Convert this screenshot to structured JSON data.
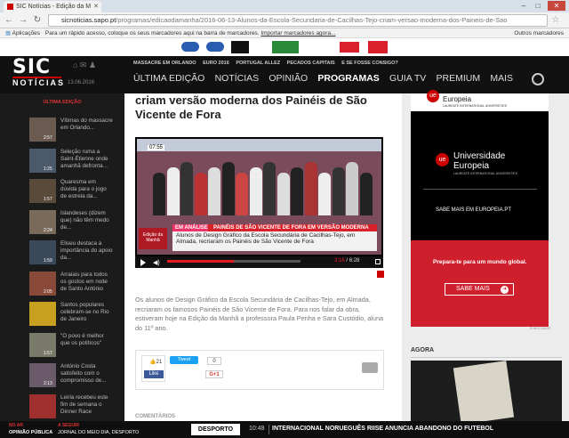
{
  "browser": {
    "tab_title": "SIC Notícias - Edição da M",
    "url_host": "sicnoticias.sapo.pt",
    "url_path": "/programas/edicaodamanha/2016-06-13-Alunos-da-Escola-Secundaria-de-Cacilhas-Tejo-criam-versao-moderna-dos-Paineis-de-Sao",
    "bookmarks_label": "Aplicações",
    "bookmarks_hint": "Para um rápido acesso, coloque os seus marcadores aqui na barra de marcadores.",
    "bookmarks_import": "Importar marcadores agora...",
    "other_bookmarks": "Outros marcadores"
  },
  "site": {
    "logo_top": "SIC",
    "logo_bottom": "NOTÍCIAS",
    "date": "13.06.2016",
    "ticker": [
      "MASSACRE EM ORLANDO",
      "EURO 2016",
      "PORTUGAL ALLEZ",
      "PECADOS CAPITAIS",
      "E SE FOSSE CONSIGO?"
    ],
    "nav": [
      "ÚLTIMA EDIÇÃO",
      "NOTÍCIAS",
      "OPINIÃO",
      "PROGRAMAS",
      "GUIA TV",
      "PREMIUM",
      "MAIS"
    ]
  },
  "sidebar": {
    "heading": "ÚLTIMA EDIÇÃO",
    "items": [
      {
        "time": "2:57",
        "text": "Vítimas do massacre em Orlando..."
      },
      {
        "time": "1:25",
        "text": "Seleção ruma a Saint-Étienne onde amanhã defronta..."
      },
      {
        "time": "1:57",
        "text": "Quaresma em dúvida para o jogo de estreia da..."
      },
      {
        "time": "2:24",
        "text": "Islandeses (dizem que) não têm medo de..."
      },
      {
        "time": "1:59",
        "text": "Eliseu destaca a importância do apoio da..."
      },
      {
        "time": "2:05",
        "text": "Arraiais para todos os gostos em noite de Santo António"
      },
      {
        "time": "",
        "text": "Santos populares celebram-se no Rio de Janeiro"
      },
      {
        "time": "1:57",
        "text": "\"O povo é melhor que os políticos\""
      },
      {
        "time": "2:13",
        "text": "António Costa satisfeito com o compromisso de..."
      },
      {
        "time": "",
        "text": "Leiria recebeu este fim de semana o Dinner Race"
      }
    ]
  },
  "article": {
    "headline_line1": "criam versão moderna dos Painéis de São",
    "headline_line2": "Vicente de Fora",
    "video_clock": "07:55",
    "lower_tag": "EM ANÁLISE",
    "lower_title": "PAINÉIS DE SÃO VICENTE DE FORA EM VERSÃO MODERNA",
    "lower_text": "Alunos de Design Gráfico da Escola Secundária de Cacilhas-Tejo, em Almada, recriaram os Painéis de São Vicente de Fora",
    "lower_logo": "Edição da Manhã",
    "time_current": "3:16",
    "time_total": "6:28",
    "progress": 0.5,
    "body": "Os alunos de Design Gráfico da Escola Secundária de Cacilhas-Tejo, em Almada, recriaram os famosos Painéis de São Vicente de Fora. Para nos falar da obra, estiveram hoje na Edição da Manhã a professora Paula Penha e Sara Custódio, aluna do 11º ano.",
    "fb_count": "21",
    "fb_like": "Like",
    "tweet": "Tweet",
    "g_count": "0",
    "g_plus": "G+1",
    "comments": "COMENTÁRIOS"
  },
  "ad": {
    "brand": "Europeia",
    "brand_sub": "LAUREATE INTERNATIONAL UNIVERSITIES",
    "title_line1": "Universidade",
    "title_line2": "Europeia",
    "more_text": "SABE MAIS EM EUROPEIA.PT",
    "prepare": "Prepara-te para um mundo global.",
    "button": "SABE MAIS",
    "label": "PUBLICIDADE"
  },
  "agora": {
    "heading": "AGORA"
  },
  "bottombar": {
    "onair_label": "NO AR",
    "onair_show": "OPINIÃO PÚBLICA",
    "next_label": "A SEGUIR",
    "next_show": "JORNAL DO MEIO DIA, DESPORTO",
    "category": "DESPORTO",
    "news_time": "10:48",
    "news_text": "INTERNACIONAL NORUEGUÊS RIISE ANUNCIA ABANDONO DO FUTEBOL"
  },
  "colors": {
    "brand_red": "#d8212b",
    "dark": "#111111",
    "fb_blue": "#3b5998"
  }
}
